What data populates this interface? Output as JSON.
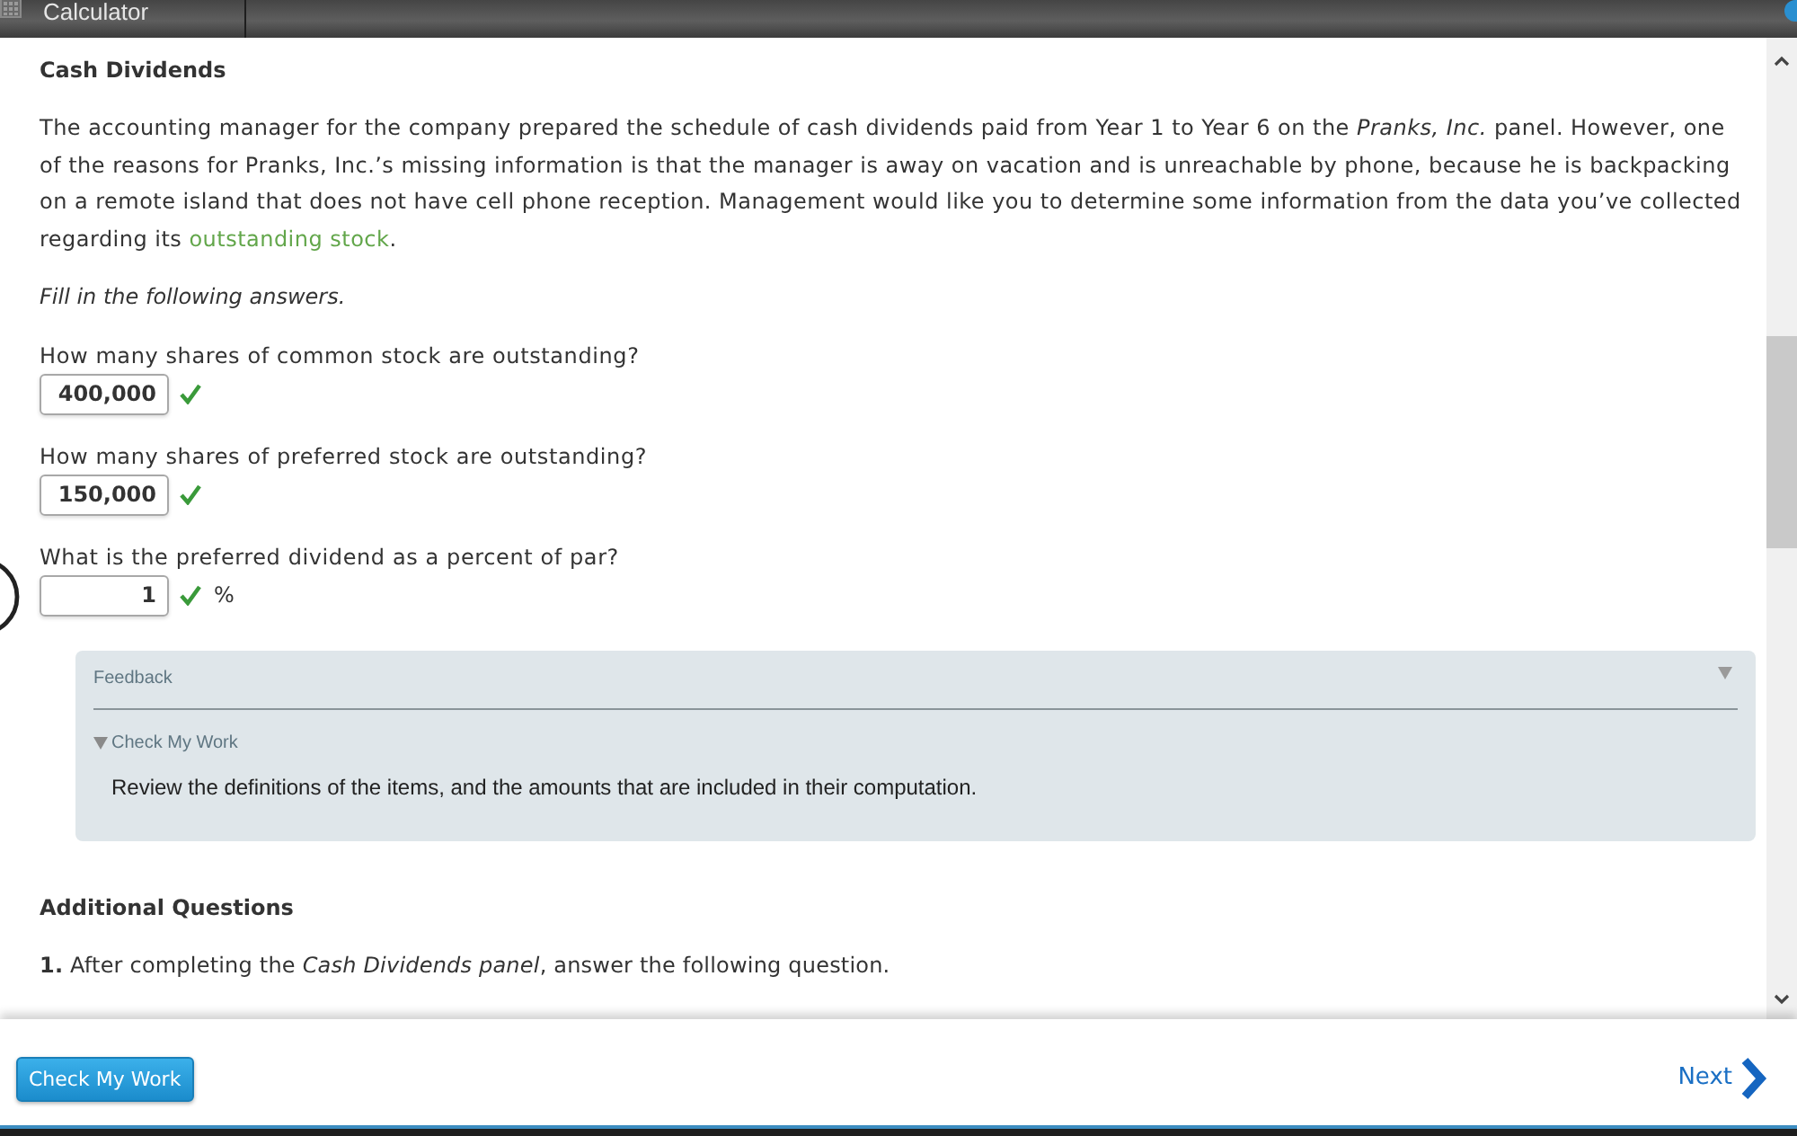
{
  "window": {
    "title": "Calculator"
  },
  "section": {
    "title": "Cash Dividends",
    "intro": {
      "text": "The accounting manager for the company prepared the schedule of cash dividends paid from Year 1 to Year 6 on the *Pranks, Inc.* panel. However, one of the reasons for Pranks, Inc.’s missing information is that the manager is away on vacation and is unreachable by phone, because he is backpacking on a remote island that does not have cell phone reception. Management would like you to determine some information from the data you’ve collected regarding its ",
      "link": "outstanding stock",
      "end": "."
    },
    "instruction": "Fill in the following answers."
  },
  "questions": [
    {
      "prompt": "How many shares of common stock are outstanding?",
      "value": "400,000",
      "correct": true
    },
    {
      "prompt": "How many shares of preferred stock are outstanding?",
      "value": "150,000",
      "correct": true
    },
    {
      "prompt": "What is the preferred dividend as a percent of par?",
      "value": "1",
      "correct": true,
      "unit": "%"
    }
  ],
  "feedback": {
    "title": "Feedback",
    "expanded": true,
    "check_my_work": {
      "title": "Check My Work",
      "expanded": true,
      "text": "Review the definitions of the items, and the amounts that are included in their computation."
    }
  },
  "additional": {
    "title": "Additional Questions",
    "items": [
      {
        "text": "**1.** After completing the *Cash Dividends panel*, answer the following question."
      }
    ]
  },
  "footer": {
    "check_button": "Check My Work",
    "next": "Next"
  }
}
